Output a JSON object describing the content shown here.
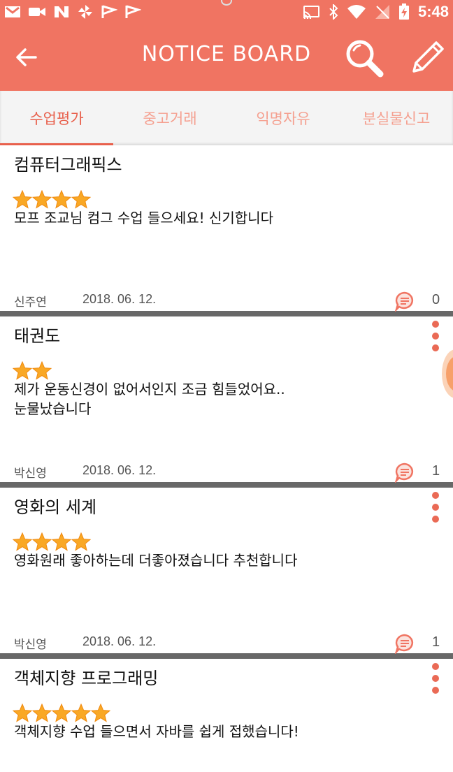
{
  "status_bar": {
    "time": "5:48",
    "left_icons": [
      "gmail-icon",
      "video-icon",
      "n-icon",
      "pinwheel-icon",
      "flag-icon",
      "flag-icon"
    ],
    "right_icons": [
      "cast-icon",
      "bluetooth-icon",
      "wifi-icon",
      "no-signal-icon",
      "battery-charging-icon"
    ]
  },
  "app_bar": {
    "title": "NOTICE BOARD",
    "back_icon": "arrow-left-icon",
    "search_icon": "search-icon",
    "write_icon": "pencil-icon",
    "color": "#f07462"
  },
  "tabs": [
    {
      "label": "수업평가",
      "active": true
    },
    {
      "label": "중고거래",
      "active": false
    },
    {
      "label": "익명자유",
      "active": false
    },
    {
      "label": "분실물신고",
      "active": false
    }
  ],
  "posts": [
    {
      "title": "컴퓨터그래픽스",
      "rating": 4,
      "body_lines": [
        "모프 조교님 컴그 수업 들으세요! 신기합니다"
      ],
      "author": "신주연",
      "date": "2018. 06. 12.",
      "comments": "0"
    },
    {
      "title": "태권도",
      "rating": 2,
      "body_lines": [
        "제가 운동신경이 없어서인지 조금 힘들었어요..",
        "눈물났습니다"
      ],
      "author": "박신영",
      "date": "2018. 06. 12.",
      "comments": "1"
    },
    {
      "title": "영화의 세계",
      "rating": 4,
      "body_lines": [
        "영화원래 좋아하는데 더좋아졌습니다 추천합니다"
      ],
      "author": "박신영",
      "date": "2018. 06. 12.",
      "comments": "1"
    },
    {
      "title": "객체지향 프로그래밍",
      "rating": 5,
      "body_lines": [
        "객체지향 수업 들으면서 자바를 쉽게 접했습니다!"
      ],
      "author": "",
      "date": "",
      "comments": ""
    }
  ],
  "colors": {
    "accent": "#f07462",
    "tab_active": "#e8604c",
    "tab_inactive": "#f5a090",
    "star": "#f9a825",
    "divider": "#686868",
    "more_dots": "#ea6a55"
  }
}
